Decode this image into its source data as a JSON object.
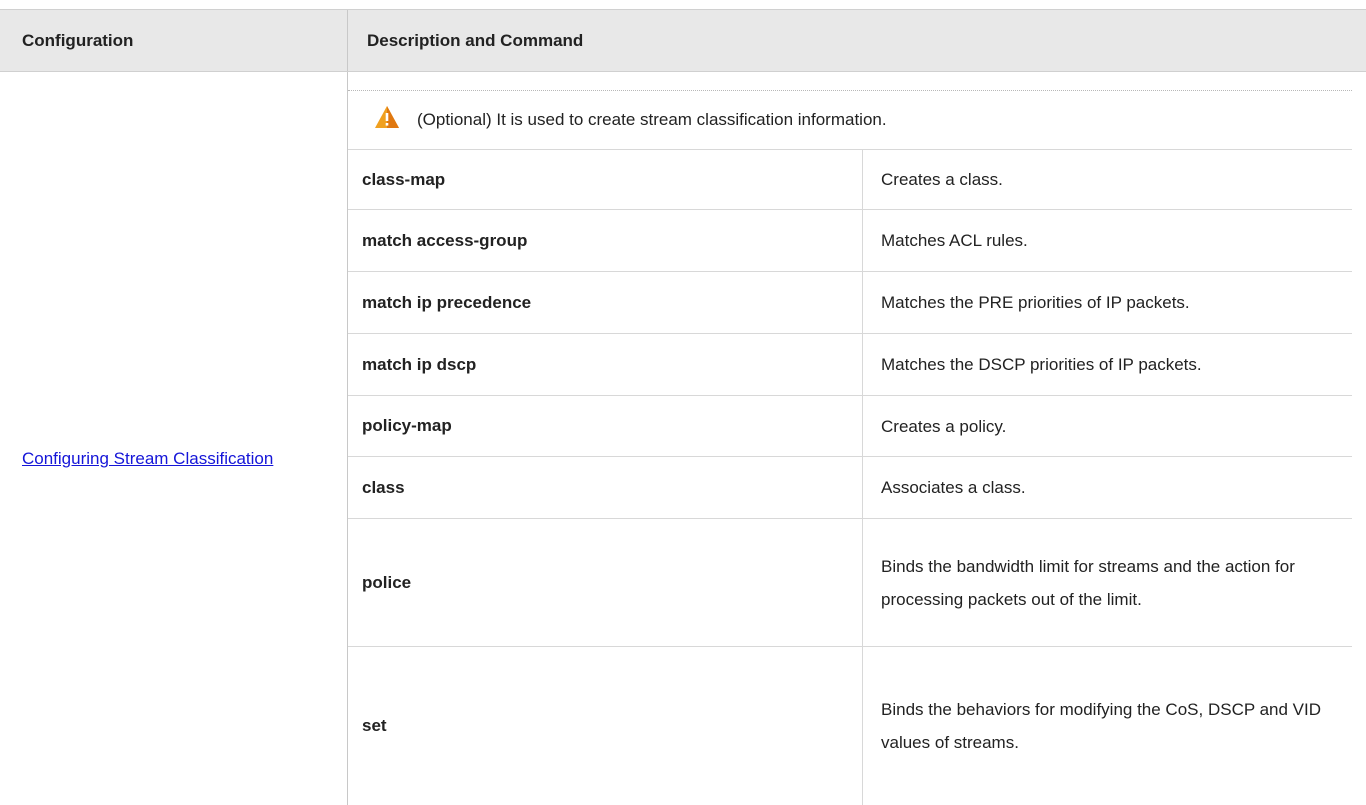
{
  "header": {
    "configuration": "Configuration",
    "description": "Description and Command"
  },
  "config_link": "Configuring Stream Classification",
  "note": {
    "icon": "warning-icon",
    "text": "(Optional) It is used to create stream classification information."
  },
  "commands": [
    {
      "command": "class-map",
      "description": "Creates a class."
    },
    {
      "command": "match access-group",
      "description": "Matches ACL rules."
    },
    {
      "command": "match ip precedence",
      "description": "Matches the PRE priorities of IP packets."
    },
    {
      "command": "match ip dscp",
      "description": "Matches the DSCP priorities of IP packets."
    },
    {
      "command": "policy-map",
      "description": "Creates a policy."
    },
    {
      "command": "class",
      "description": "Associates a class."
    },
    {
      "command": "police",
      "description": "Binds the bandwidth limit for streams and the action for processing packets out of the limit."
    },
    {
      "command": "set",
      "description": "Binds the behaviors for modifying the CoS, DSCP and VID values of streams."
    }
  ],
  "colors": {
    "header_bg": "#e8e8e8",
    "link": "#1515d8",
    "warning": "#f0a020"
  }
}
